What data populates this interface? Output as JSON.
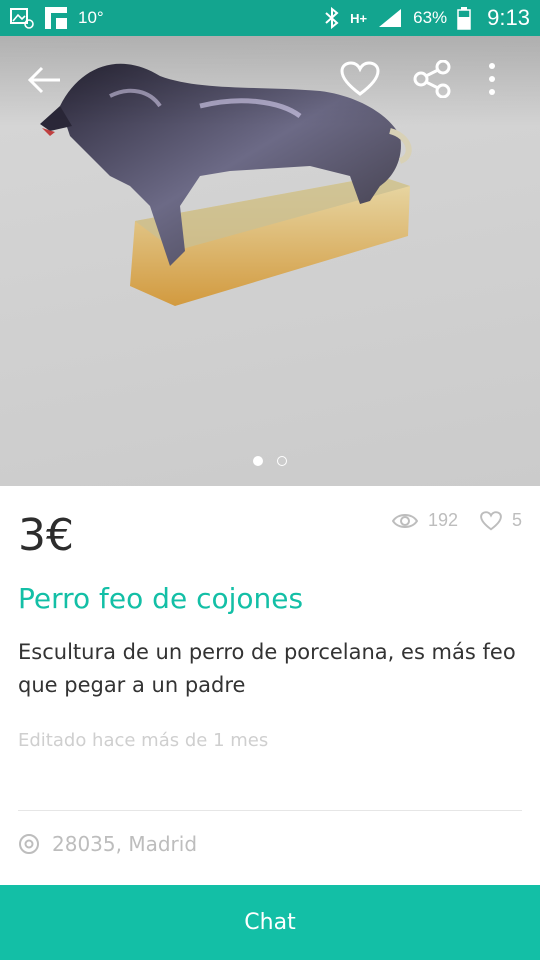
{
  "status_bar": {
    "temperature": "10°",
    "network": "H+",
    "battery": "63%",
    "time": "9:13"
  },
  "photo": {
    "pages": 2,
    "current_page": 1
  },
  "header": {
    "back_icon": "back-arrow-icon",
    "favorite_icon": "heart-icon",
    "share_icon": "share-icon",
    "more_icon": "more-vert-icon"
  },
  "listing": {
    "price": "3€",
    "views": "192",
    "favorites": "5",
    "title": "Perro feo de cojones",
    "description": "Escultura de un perro de porcelana, es más feo que pegar a un padre",
    "edited": "Editado hace más de 1 mes",
    "location": "28035, Madrid"
  },
  "actions": {
    "chat_label": "Chat"
  },
  "colors": {
    "brand": "#13bfa6",
    "status_bar": "#13a58f",
    "muted": "#bdbdbd"
  }
}
